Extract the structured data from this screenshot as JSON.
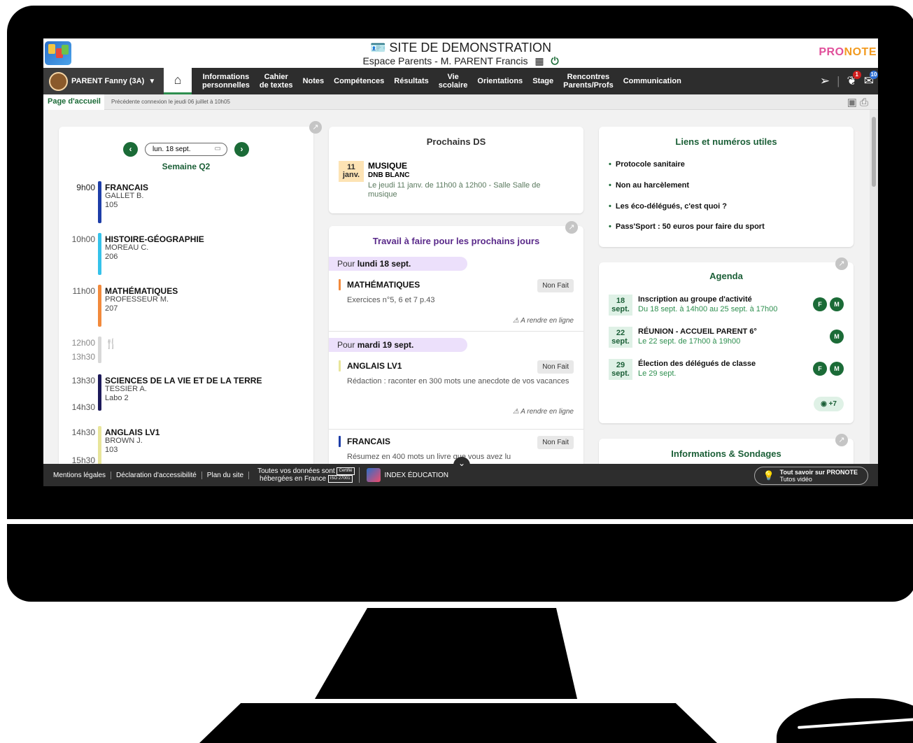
{
  "header": {
    "site_title": "SITE DE DEMONSTRATION",
    "site_subtitle": "Espace Parents - M. PARENT Francis",
    "brand": "PRONOTE"
  },
  "nav": {
    "user": "PARENT Fanny (3A)",
    "items": [
      "Informations\npersonnelles",
      "Cahier\nde textes",
      "Notes",
      "Compétences",
      "Résultats",
      "Vie\nscolaire",
      "Orientations",
      "Stage",
      "Rencontres\nParents/Profs",
      "Communication"
    ],
    "badges": {
      "discussions": "1",
      "documents": "10"
    }
  },
  "subbar": {
    "tab": "Page d'accueil",
    "last_connection": "Précédente connexion le jeudi 06 juillet à 10h05"
  },
  "timetable": {
    "date": "lun. 18 sept.",
    "week": "Semaine Q2",
    "slots": [
      {
        "time": "9h00",
        "subject": "FRANCAIS",
        "teacher": "GALLET B.",
        "room": "105",
        "color": "#1e3ea8"
      },
      {
        "time": "10h00",
        "subject": "HISTOIRE-GÉOGRAPHIE",
        "teacher": "MOREAU C.",
        "room": "206",
        "color": "#35c2ea"
      },
      {
        "time": "11h00",
        "subject": "MATHÉMATIQUES",
        "teacher": "PROFESSEUR M.",
        "room": "207",
        "color": "#f28a3c"
      },
      {
        "time": "12h00",
        "end": "13h30",
        "subject": "",
        "color": "#d8d8d8"
      },
      {
        "time": "13h30",
        "end": "14h30",
        "subject": "SCIENCES DE LA VIE ET DE LA TERRE",
        "teacher": "TESSIER A.",
        "room": "Labo 2",
        "color": "#1d1a5a"
      },
      {
        "time": "14h30",
        "end": "15h30",
        "subject": "ANGLAIS LV1",
        "teacher": "BROWN J.",
        "room": "103",
        "color": "#e8e59a"
      }
    ]
  },
  "ds": {
    "title": "Prochains DS",
    "day": "11",
    "month": "janv.",
    "subject": "MUSIQUE",
    "type": "DNB BLANC",
    "desc": "Le jeudi 11 janv. de 11h00 à 12h00  - Salle Salle de musique"
  },
  "homework": {
    "title": "Travail à faire pour les prochains jours",
    "day1_prefix": "Pour ",
    "day1": "lundi 18 sept.",
    "day2_prefix": "Pour ",
    "day2": "mardi 19 sept.",
    "items": [
      {
        "subject": "MATHÉMATIQUES",
        "status": "Non Fait",
        "desc": "Exercices n°5, 6 et 7 p.43",
        "online": "⚠ A rendre en ligne",
        "color": "#f28a3c"
      },
      {
        "subject": "ANGLAIS LV1",
        "status": "Non Fait",
        "desc": "Rédaction : raconter en 300 mots une anecdote de vos vacances",
        "online": "⚠ A rendre en ligne",
        "color": "#e8e59a"
      },
      {
        "subject": "FRANCAIS",
        "status": "Non Fait",
        "desc": "Résumez en 400 mots un livre que vous avez lu",
        "color": "#1e3ea8"
      }
    ]
  },
  "links": {
    "title": "Liens et numéros utiles",
    "items": [
      "Protocole sanitaire",
      "Non au harcèlement",
      "Les éco-délégués, c'est quoi ?",
      "Pass'Sport : 50 euros pour faire du sport"
    ]
  },
  "agenda": {
    "title": "Agenda",
    "items": [
      {
        "day": "18",
        "month": "sept.",
        "title": "Inscription au groupe d'activité",
        "sub": "Du 18 sept. à 14h00 au 25 sept. à 17h00"
      },
      {
        "day": "22",
        "month": "sept.",
        "title": "RÉUNION - ACCUEIL PARENT 6°",
        "sub": "Le 22 sept. de 17h00 à 19h00"
      },
      {
        "day": "29",
        "month": "sept.",
        "title": "Élection des délégués de classe",
        "sub": "Le 29 sept."
      }
    ],
    "more": "+7"
  },
  "infos": {
    "title": "Informations & Sondages"
  },
  "footer": {
    "links": [
      "Mentions légales",
      "Déclaration d'accessibilité",
      "Plan du site"
    ],
    "hosting_line1": "Toutes vos données sont",
    "hosting_line2": "hébergées en France",
    "cert_line1": "Certifié",
    "cert_line2": "ISO 27001",
    "index": "INDEX ÉDUCATION",
    "help_title": "Tout savoir sur PRONOTE",
    "help_sub": "Tutos vidéo"
  },
  "colors": {
    "primary": "#1b6b37",
    "nav_bg": "#2d2d2d",
    "accent_green": "#2e8f4f"
  }
}
